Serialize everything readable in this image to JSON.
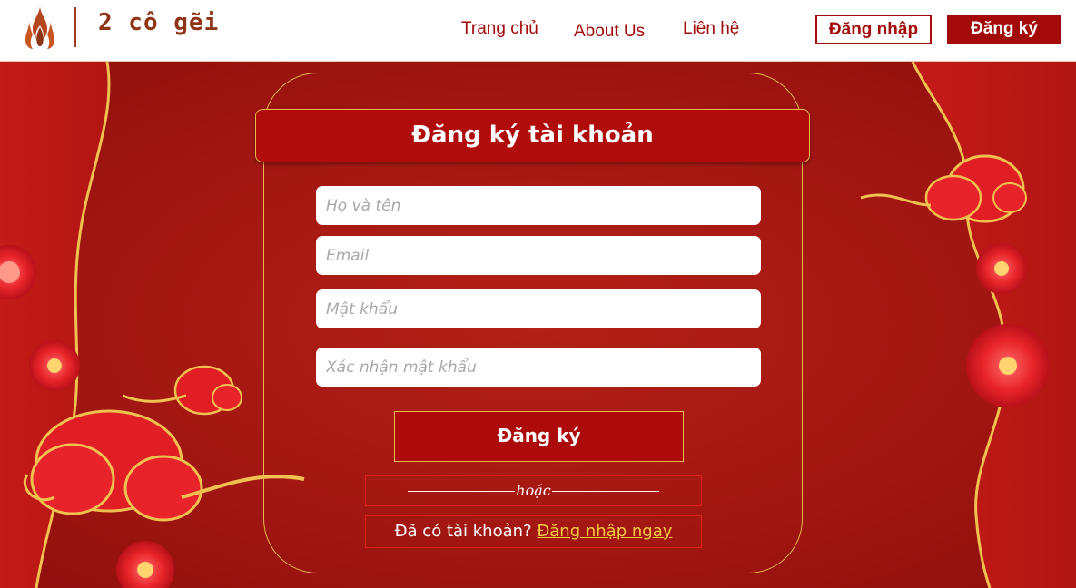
{
  "header": {
    "brand": "2 cô gẽi",
    "nav": {
      "home": "Trang chủ",
      "about": "About Us",
      "contact": "Liên hệ"
    },
    "login_button": "Đăng nhập",
    "register_button": "Đăng ký",
    "logo_icon": "flame-logo-icon"
  },
  "form": {
    "title": "Đăng ký tài khoản",
    "fields": {
      "name_placeholder": "Họ và tên",
      "email_placeholder": "Email",
      "password_placeholder": "Mật khẩu",
      "confirm_placeholder": "Xác nhận mật khẩu"
    },
    "submit_label": "Đăng ký",
    "or_text": "hoặc",
    "have_account_text": "Đã có tài khoản?",
    "login_link": "Đăng nhập ngay"
  },
  "colors": {
    "primary_red": "#a30b0b",
    "accent_gold": "#e8b84a",
    "link_gold": "#f5c842"
  }
}
